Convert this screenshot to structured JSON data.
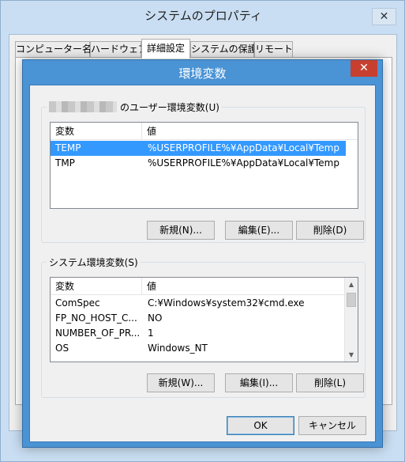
{
  "back_window": {
    "title": "システムのプロパティ",
    "close_glyph": "✕",
    "tabs": [
      {
        "label": "コンピューター名"
      },
      {
        "label": "ハードウェア"
      },
      {
        "label": "詳細設定"
      },
      {
        "label": "システムの保護"
      },
      {
        "label": "リモート"
      }
    ]
  },
  "dialog": {
    "title": "環境変数",
    "close_glyph": "✕",
    "user_section": {
      "label_suffix": "のユーザー環境変数(U)",
      "columns": [
        "変数",
        "値"
      ],
      "rows": [
        {
          "name": "TEMP",
          "value": "%USERPROFILE%¥AppData¥Local¥Temp",
          "selected": true
        },
        {
          "name": "TMP",
          "value": "%USERPROFILE%¥AppData¥Local¥Temp",
          "selected": false
        }
      ],
      "buttons": {
        "new": "新規(N)...",
        "edit": "編集(E)...",
        "delete": "削除(D)"
      }
    },
    "system_section": {
      "label": "システム環境変数(S)",
      "columns": [
        "変数",
        "値"
      ],
      "rows": [
        {
          "name": "ComSpec",
          "value": "C:¥Windows¥system32¥cmd.exe"
        },
        {
          "name": "FP_NO_HOST_C...",
          "value": "NO"
        },
        {
          "name": "NUMBER_OF_PR...",
          "value": "1"
        },
        {
          "name": "OS",
          "value": "Windows_NT"
        }
      ],
      "buttons": {
        "new": "新規(W)...",
        "edit": "編集(I)...",
        "delete": "削除(L)"
      }
    },
    "ok_label": "OK",
    "cancel_label": "キャンセル"
  }
}
